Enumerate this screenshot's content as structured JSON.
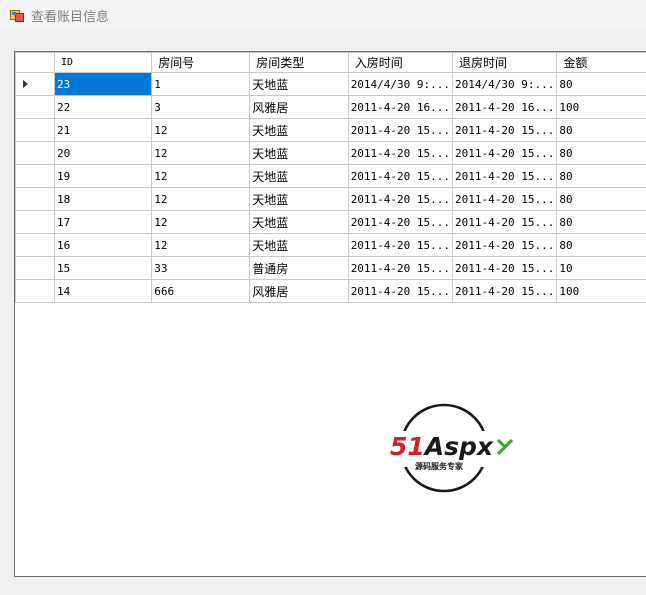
{
  "window": {
    "title": "查看账目信息"
  },
  "grid": {
    "columns": [
      "ID",
      "房间号",
      "房间类型",
      "入房时间",
      "退房时间",
      "金额"
    ],
    "rows": [
      [
        "23",
        "1",
        "天地蓝",
        "2014/4/30 9:...",
        "2014/4/30 9:...",
        "80"
      ],
      [
        "22",
        "3",
        "风雅居",
        "2011-4-20 16...",
        "2011-4-20 16...",
        "100"
      ],
      [
        "21",
        "12",
        "天地蓝",
        "2011-4-20 15...",
        "2011-4-20 15...",
        "80"
      ],
      [
        "20",
        "12",
        "天地蓝",
        "2011-4-20 15...",
        "2011-4-20 15...",
        "80"
      ],
      [
        "19",
        "12",
        "天地蓝",
        "2011-4-20 15...",
        "2011-4-20 15...",
        "80"
      ],
      [
        "18",
        "12",
        "天地蓝",
        "2011-4-20 15...",
        "2011-4-20 15...",
        "80"
      ],
      [
        "17",
        "12",
        "天地蓝",
        "2011-4-20 15...",
        "2011-4-20 15...",
        "80"
      ],
      [
        "16",
        "12",
        "天地蓝",
        "2011-4-20 15...",
        "2011-4-20 15...",
        "80"
      ],
      [
        "15",
        "33",
        "普通房",
        "2011-4-20 15...",
        "2011-4-20 15...",
        "10"
      ],
      [
        "14",
        "666",
        "风雅居",
        "2011-4-20 15...",
        "2011-4-20 15...",
        "100"
      ]
    ],
    "current_row_index": 0,
    "selection_color": "#0078d7"
  },
  "watermark": {
    "brand": "51Aspx",
    "tagline": "源码服务专家",
    "icon": "51aspx-logo"
  }
}
